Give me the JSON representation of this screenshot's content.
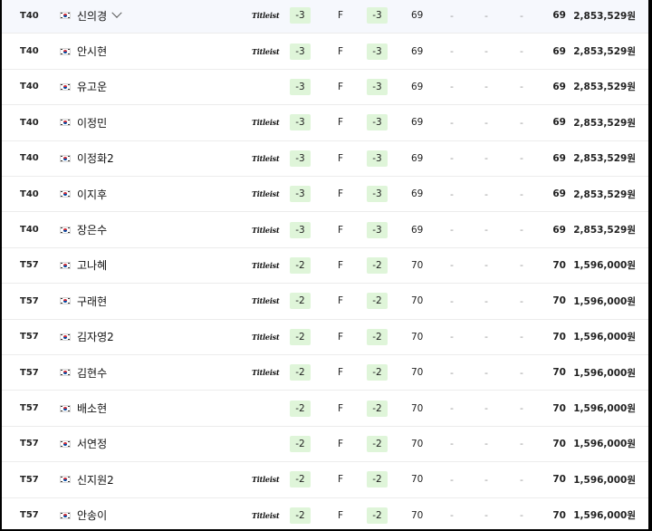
{
  "leaderboard": {
    "rows": [
      {
        "rank": "T40",
        "name": "신의경",
        "sponsor": "Titleist",
        "to_par": "-3",
        "thru": "F",
        "today": "-3",
        "r1": "69",
        "r2": "-",
        "r3": "-",
        "r4": "-",
        "total": "69",
        "prize": "2,853,529원",
        "expanded_toggle": true
      },
      {
        "rank": "T40",
        "name": "안시현",
        "sponsor": "Titleist",
        "to_par": "-3",
        "thru": "F",
        "today": "-3",
        "r1": "69",
        "r2": "-",
        "r3": "-",
        "r4": "-",
        "total": "69",
        "prize": "2,853,529원"
      },
      {
        "rank": "T40",
        "name": "유고운",
        "sponsor": "",
        "to_par": "-3",
        "thru": "F",
        "today": "-3",
        "r1": "69",
        "r2": "-",
        "r3": "-",
        "r4": "-",
        "total": "69",
        "prize": "2,853,529원"
      },
      {
        "rank": "T40",
        "name": "이정민",
        "sponsor": "Titleist",
        "to_par": "-3",
        "thru": "F",
        "today": "-3",
        "r1": "69",
        "r2": "-",
        "r3": "-",
        "r4": "-",
        "total": "69",
        "prize": "2,853,529원"
      },
      {
        "rank": "T40",
        "name": "이정화2",
        "sponsor": "Titleist",
        "to_par": "-3",
        "thru": "F",
        "today": "-3",
        "r1": "69",
        "r2": "-",
        "r3": "-",
        "r4": "-",
        "total": "69",
        "prize": "2,853,529원"
      },
      {
        "rank": "T40",
        "name": "이지후",
        "sponsor": "Titleist",
        "to_par": "-3",
        "thru": "F",
        "today": "-3",
        "r1": "69",
        "r2": "-",
        "r3": "-",
        "r4": "-",
        "total": "69",
        "prize": "2,853,529원"
      },
      {
        "rank": "T40",
        "name": "장은수",
        "sponsor": "Titleist",
        "to_par": "-3",
        "thru": "F",
        "today": "-3",
        "r1": "69",
        "r2": "-",
        "r3": "-",
        "r4": "-",
        "total": "69",
        "prize": "2,853,529원"
      },
      {
        "rank": "T57",
        "name": "고나혜",
        "sponsor": "Titleist",
        "to_par": "-2",
        "thru": "F",
        "today": "-2",
        "r1": "70",
        "r2": "-",
        "r3": "-",
        "r4": "-",
        "total": "70",
        "prize": "1,596,000원"
      },
      {
        "rank": "T57",
        "name": "구래현",
        "sponsor": "Titleist",
        "to_par": "-2",
        "thru": "F",
        "today": "-2",
        "r1": "70",
        "r2": "-",
        "r3": "-",
        "r4": "-",
        "total": "70",
        "prize": "1,596,000원"
      },
      {
        "rank": "T57",
        "name": "김자영2",
        "sponsor": "Titleist",
        "to_par": "-2",
        "thru": "F",
        "today": "-2",
        "r1": "70",
        "r2": "-",
        "r3": "-",
        "r4": "-",
        "total": "70",
        "prize": "1,596,000원"
      },
      {
        "rank": "T57",
        "name": "김현수",
        "sponsor": "Titleist",
        "to_par": "-2",
        "thru": "F",
        "today": "-2",
        "r1": "70",
        "r2": "-",
        "r3": "-",
        "r4": "-",
        "total": "70",
        "prize": "1,596,000원"
      },
      {
        "rank": "T57",
        "name": "배소현",
        "sponsor": "",
        "to_par": "-2",
        "thru": "F",
        "today": "-2",
        "r1": "70",
        "r2": "-",
        "r3": "-",
        "r4": "-",
        "total": "70",
        "prize": "1,596,000원"
      },
      {
        "rank": "T57",
        "name": "서연정",
        "sponsor": "",
        "to_par": "-2",
        "thru": "F",
        "today": "-2",
        "r1": "70",
        "r2": "-",
        "r3": "-",
        "r4": "-",
        "total": "70",
        "prize": "1,596,000원"
      },
      {
        "rank": "T57",
        "name": "신지원2",
        "sponsor": "Titleist",
        "to_par": "-2",
        "thru": "F",
        "today": "-2",
        "r1": "70",
        "r2": "-",
        "r3": "-",
        "r4": "-",
        "total": "70",
        "prize": "1,596,000원"
      },
      {
        "rank": "T57",
        "name": "안송이",
        "sponsor": "Titleist",
        "to_par": "-2",
        "thru": "F",
        "today": "-2",
        "r1": "70",
        "r2": "-",
        "r3": "-",
        "r4": "-",
        "total": "70",
        "prize": "1,596,000원"
      }
    ]
  },
  "colors": {
    "score_badge_bg": "#dff5d9",
    "highlight_row_bg": "#f6f8fd"
  },
  "icons": {
    "flag": "south-korea-flag-icon",
    "expand": "chevron-down-icon"
  }
}
